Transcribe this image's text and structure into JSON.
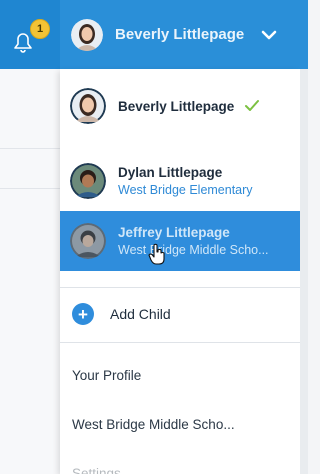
{
  "notifications": {
    "count": "1"
  },
  "header": {
    "current_user": "Beverly Littlepage"
  },
  "accounts": [
    {
      "name": "Beverly Littlepage",
      "school": "",
      "selected": true
    },
    {
      "name": "Dylan Littlepage",
      "school": "West Bridge Elementary",
      "selected": false
    },
    {
      "name": "Jeffrey Littlepage",
      "school": "West Bridge Middle Scho...",
      "selected": false,
      "hovered": true
    }
  ],
  "actions": {
    "add_child": "Add Child"
  },
  "menu": {
    "your_profile": "Your Profile",
    "school": "West Bridge Middle Scho...",
    "settings": "Settings"
  },
  "colors": {
    "primary": "#2a8fd8",
    "accent_check": "#7cc142",
    "badge": "#f3c335",
    "hover_row": "#2f8ddc"
  }
}
